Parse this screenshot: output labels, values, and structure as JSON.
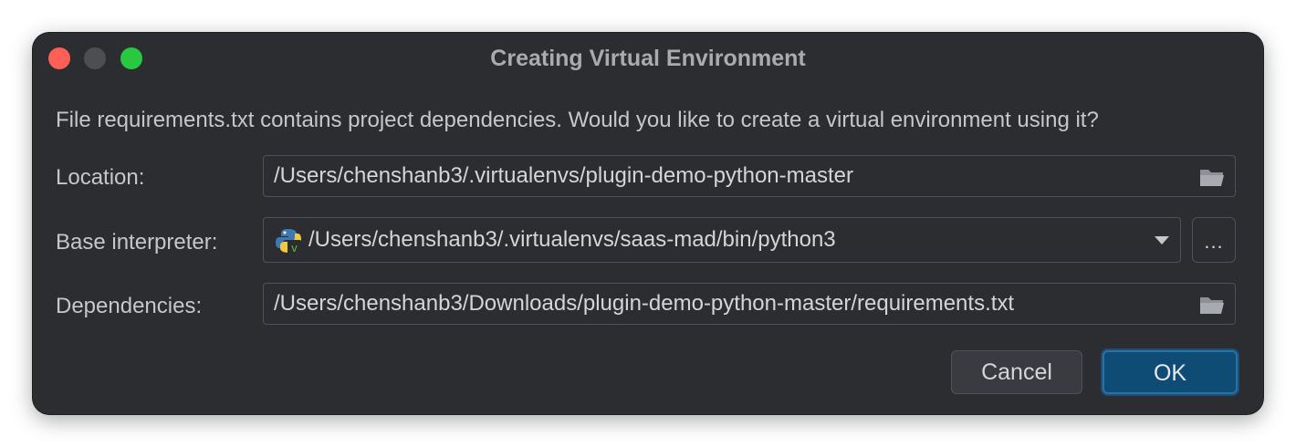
{
  "window": {
    "title": "Creating Virtual Environment"
  },
  "message": "File requirements.txt contains project dependencies. Would you like to create a virtual environment using it?",
  "location": {
    "label": "Location:",
    "value": "/Users/chenshanb3/.virtualenvs/plugin-demo-python-master",
    "icon": "folder-icon"
  },
  "base_interpreter": {
    "label": "Base interpreter:",
    "value": "/Users/chenshanb3/.virtualenvs/saas-mad/bin/python3",
    "icon": "python-venv-icon",
    "browse_label": "..."
  },
  "dependencies": {
    "label": "Dependencies:",
    "value": "/Users/chenshanb3/Downloads/plugin-demo-python-master/requirements.txt",
    "icon": "folder-icon"
  },
  "buttons": {
    "cancel": "Cancel",
    "ok": "OK"
  },
  "colors": {
    "background": "#2b2d30",
    "accent": "#0f4c75",
    "close": "#fe5f57",
    "zoom": "#28c840"
  }
}
